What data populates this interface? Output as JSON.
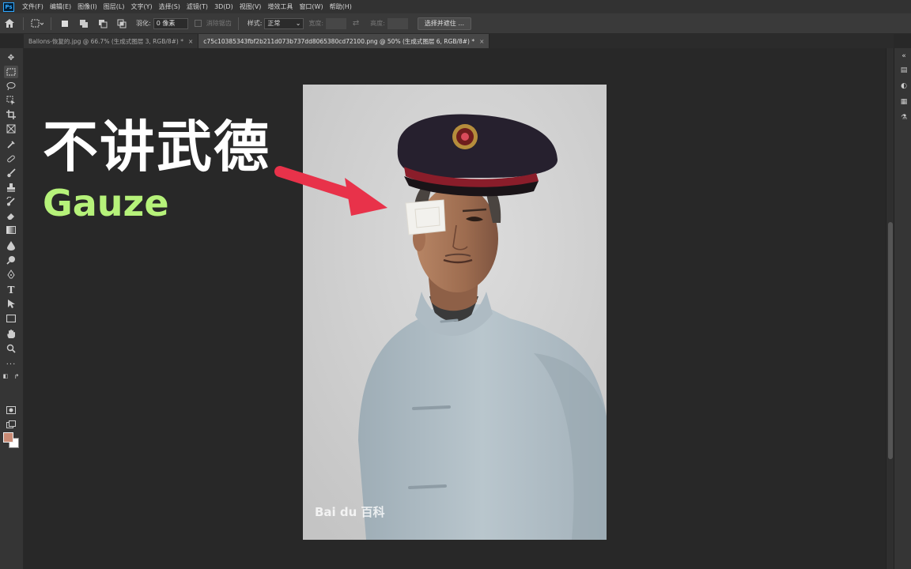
{
  "app": {
    "logo_text": "Ps",
    "menu": [
      "文件(F)",
      "编辑(E)",
      "图像(I)",
      "图层(L)",
      "文字(Y)",
      "选择(S)",
      "滤镜(T)",
      "3D(D)",
      "视图(V)",
      "增效工具",
      "窗口(W)",
      "帮助(H)"
    ]
  },
  "options": {
    "feather_label": "羽化:",
    "feather_value": "0 像素",
    "antialias_label": "消除锯齿",
    "style_label": "样式:",
    "style_value": "正常",
    "width_label": "宽度:",
    "height_label": "高度:",
    "select_mask_button": "选择并遮住 ..."
  },
  "tabs": [
    {
      "label": "Ballons-恢复的.jpg @ 66.7% (生成式图层 3, RGB/8#) *",
      "close": "×"
    },
    {
      "label": "c75c10385343fbf2b211d073b737dd8065380cd72100.png @ 50% (生成式图层 6, RGB/8#) *",
      "close": "×"
    }
  ],
  "overlay": {
    "title": "不讲武德",
    "subtitle": "Gauze",
    "subtitle_color": "#b6f27a",
    "arrow_color": "#e8324a"
  },
  "photo": {
    "watermark": "Bai du 百科"
  },
  "colors": {
    "foreground": "#c98a74",
    "background": "#ffffff"
  },
  "tools": [
    "move-tool-icon",
    "marquee-tool-icon",
    "lasso-tool-icon",
    "object-select-icon",
    "crop-tool-icon",
    "frame-tool-icon",
    "eyedropper-icon",
    "healing-brush-icon",
    "brush-tool-icon",
    "clone-stamp-icon",
    "history-brush-icon",
    "eraser-icon",
    "gradient-tool-icon",
    "blur-tool-icon",
    "dodge-tool-icon",
    "pen-tool-icon",
    "type-tool-icon",
    "path-select-icon",
    "rectangle-tool-icon",
    "hand-tool-icon",
    "zoom-tool-icon",
    "more-tools-icon"
  ]
}
